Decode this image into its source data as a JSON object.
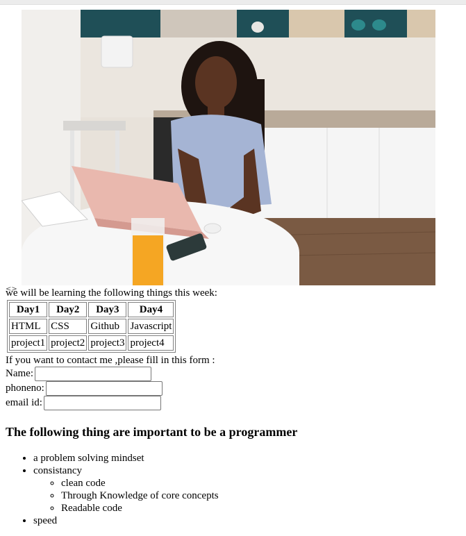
{
  "image": {
    "alt_icon": "<>"
  },
  "intro_text": "we will be learning the following things this week:",
  "schedule": {
    "headers": [
      "Day1",
      "Day2",
      "Day3",
      "Day4"
    ],
    "rows": [
      [
        "HTML",
        "CSS",
        "Github",
        "Javascript"
      ],
      [
        "project1",
        "project2",
        "project3",
        "project4"
      ]
    ]
  },
  "form": {
    "intro": "If you want to contact me ,please fill in this form :",
    "fields": [
      {
        "label": "Name:",
        "value": ""
      },
      {
        "label": "phoneno:",
        "value": ""
      },
      {
        "label": "email id:",
        "value": ""
      }
    ]
  },
  "heading": "The following thing are important to be a programmer",
  "list": {
    "item1": "a problem solving mindset",
    "item2": "consistancy",
    "sub_items": [
      "clean code",
      "Through Knowledge of core concepts",
      "Readable code"
    ],
    "item3": "speed"
  }
}
